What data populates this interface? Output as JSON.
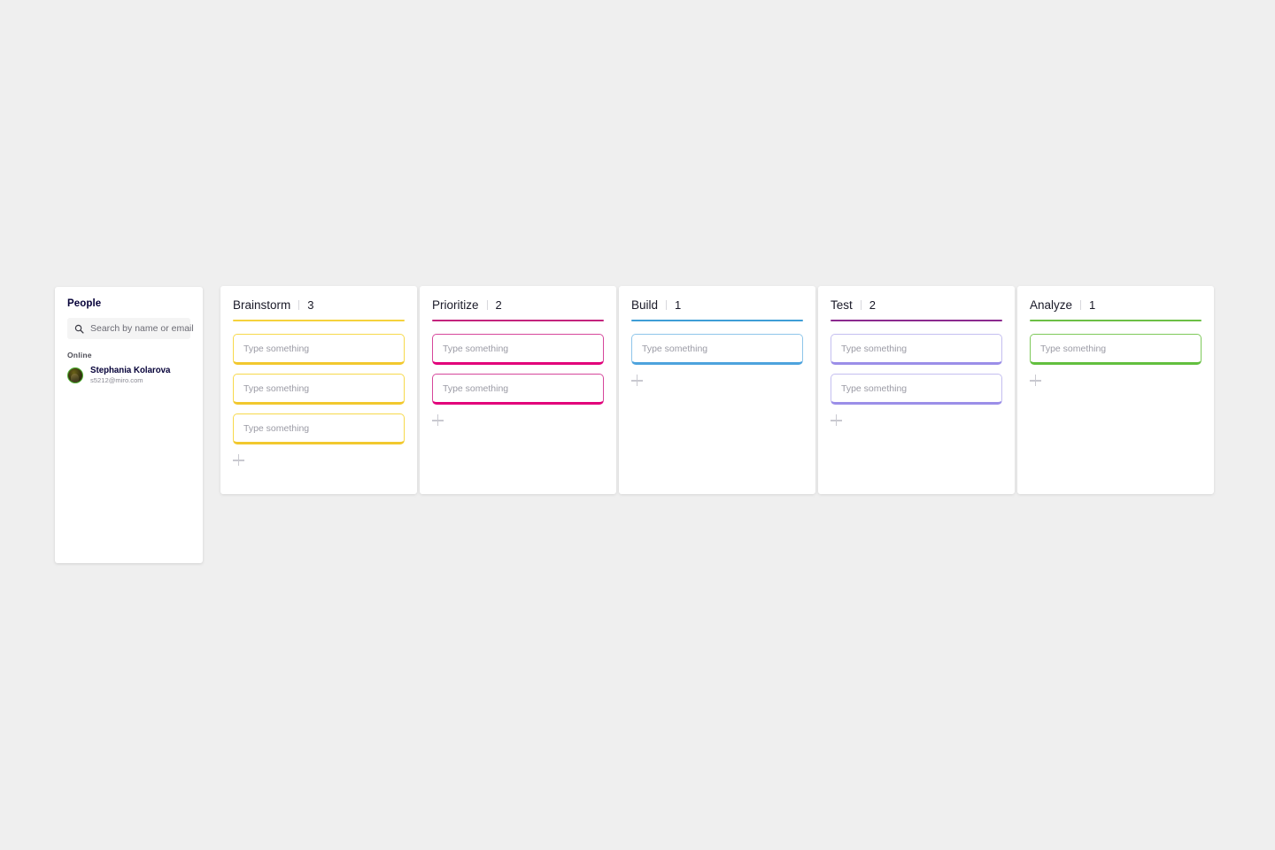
{
  "background_color": "#efefef",
  "people_panel": {
    "title": "People",
    "search": {
      "placeholder": "Search by name or email",
      "value": "",
      "icon": "search-icon"
    },
    "group_label": "Online",
    "members": [
      {
        "name": "Stephania Kolarova",
        "email": "s5212@miro.com",
        "status": "online",
        "status_color": "#4caf2f"
      }
    ]
  },
  "board": {
    "card_placeholder": "Type something",
    "add_label": "+",
    "columns": [
      {
        "title": "Brainstorm",
        "count": "3",
        "divider": "|",
        "rule_color": "#f5d23c",
        "card_border_color": "#f7d94b",
        "card_accent_color": "#f2c82e",
        "cards": [
          {
            "placeholder": "Type something",
            "value": ""
          },
          {
            "placeholder": "Type something",
            "value": ""
          },
          {
            "placeholder": "Type something",
            "value": ""
          }
        ]
      },
      {
        "title": "Prioritize",
        "count": "2",
        "divider": "|",
        "rule_color": "#c4247d",
        "card_border_color": "#d6479b",
        "card_accent_color": "#e2007a",
        "cards": [
          {
            "placeholder": "Type something",
            "value": ""
          },
          {
            "placeholder": "Type something",
            "value": ""
          }
        ]
      },
      {
        "title": "Build",
        "count": "1",
        "divider": "|",
        "rule_color": "#3e9ed6",
        "card_border_color": "#8ec5ea",
        "card_accent_color": "#4da3dd",
        "cards": [
          {
            "placeholder": "Type something",
            "value": ""
          }
        ]
      },
      {
        "title": "Test",
        "count": "2",
        "divider": "|",
        "rule_color": "#8b2a8f",
        "card_border_color": "#c4bef0",
        "card_accent_color": "#9b8ee8",
        "cards": [
          {
            "placeholder": "Type something",
            "value": ""
          },
          {
            "placeholder": "Type something",
            "value": ""
          }
        ]
      },
      {
        "title": "Analyze",
        "count": "1",
        "divider": "|",
        "rule_color": "#6cbf45",
        "card_border_color": "#7ec95a",
        "card_accent_color": "#62bf3e",
        "cards": [
          {
            "placeholder": "Type something",
            "value": ""
          }
        ]
      }
    ]
  }
}
